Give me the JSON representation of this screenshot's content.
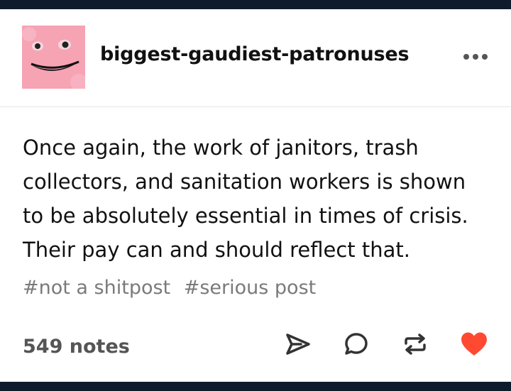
{
  "post": {
    "username": "biggest-gaudiest-patronuses",
    "avatar_icon": "pink-blob-face-avatar",
    "body_lines": [
      "Once again, the work of janitors, trash",
      "collectors, and sanitation workers is shown",
      "to be absolutely essential in times of crisis.",
      "Their pay can and should reflect that."
    ],
    "tags": [
      "#not a shitpost",
      "#serious post"
    ],
    "notes": "549 notes"
  },
  "actions": {
    "more_icon": "ellipsis-icon",
    "share_icon": "send-icon",
    "reply_icon": "speech-bubble-icon",
    "reblog_icon": "reblog-icon",
    "like_icon": "heart-icon"
  },
  "colors": {
    "frame": "#0e1b2c",
    "like": "#ff4930",
    "icon": "#333333",
    "tag_text": "#7a7a7a"
  }
}
